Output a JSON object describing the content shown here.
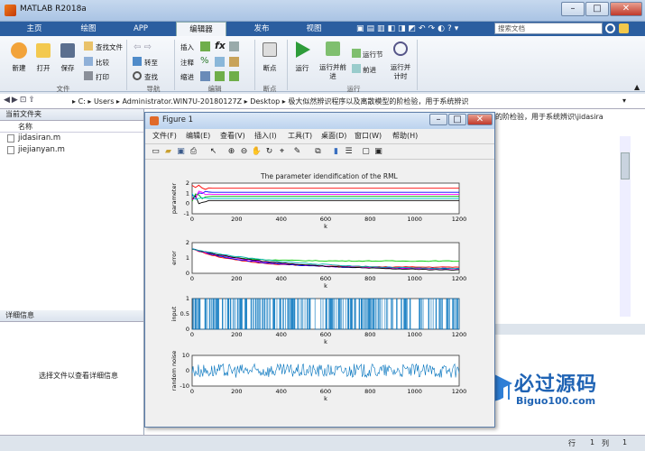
{
  "window": {
    "title": "MATLAB R2018a"
  },
  "tabs": [
    "主页",
    "绘图",
    "APP",
    "编辑器",
    "发布",
    "视图"
  ],
  "search": {
    "placeholder": "搜索文档"
  },
  "ribbon": {
    "file": [
      "新建",
      "打开",
      "保存"
    ],
    "file_small": [
      "查找文件",
      "比较",
      "打印"
    ],
    "nav": [
      "转至",
      "查找"
    ],
    "edit": [
      "插入",
      "注释",
      "缩进"
    ],
    "breakpoint": "断点",
    "run": [
      "运行",
      "运行并前进",
      "运行节",
      "前进",
      "运行并计时"
    ],
    "groups": [
      "文件",
      "导航",
      "编辑",
      "断点",
      "运行"
    ]
  },
  "address": {
    "path": [
      "C:",
      "Users",
      "Administrator.WIN7U-20180127Z",
      "Desktop",
      "极大似然辨识程序以及离散模型的阶检验，用于系统辨识"
    ]
  },
  "current_folder": {
    "title": "当前文件夹",
    "column": "名称",
    "files": [
      "jidasiran.m",
      "jiejianyan.m"
    ]
  },
  "details": {
    "title": "详细信息",
    "message": "选择文件以查看详细信息"
  },
  "right_path_text": "的阶检验，用于系统辨识\\jidasira",
  "figure": {
    "title": "Figure 1",
    "menu": [
      "文件(F)",
      "编辑(E)",
      "查看(V)",
      "插入(I)",
      "工具(T)",
      "桌面(D)",
      "窗口(W)",
      "帮助(H)"
    ],
    "plot_title": "The parameter idendification of the RML"
  },
  "chart_data": [
    {
      "type": "line",
      "ylabel": "parameter",
      "xlabel": "k",
      "xlim": [
        0,
        1200
      ],
      "ylim": [
        -1,
        2
      ],
      "yticks": [
        "2",
        "1",
        "0",
        "-1"
      ],
      "xticks": [
        "0",
        "200",
        "400",
        "600",
        "800",
        "1000",
        "1200"
      ],
      "series": [
        {
          "color": "#ff0000",
          "values": [
            1.5,
            1.5,
            1.5
          ]
        },
        {
          "color": "#0000ff",
          "values": [
            1.1,
            1.1,
            1.1
          ]
        },
        {
          "color": "#00aa00",
          "values": [
            0.7,
            0.7,
            0.7
          ]
        },
        {
          "color": "#000000",
          "values": [
            0.3,
            0.3,
            0.3
          ]
        },
        {
          "color": "#ff00ff",
          "values": [
            0.9,
            0.9,
            0.9
          ]
        },
        {
          "color": "#00cccc",
          "values": [
            0.5,
            0.5,
            0.5
          ]
        }
      ]
    },
    {
      "type": "line",
      "ylabel": "error",
      "xlabel": "k",
      "xlim": [
        0,
        1200
      ],
      "ylim": [
        0,
        2
      ],
      "yticks": [
        "2",
        "1",
        "0"
      ],
      "xticks": [
        "0",
        "200",
        "400",
        "600",
        "800",
        "1000",
        "1200"
      ]
    },
    {
      "type": "line",
      "ylabel": "input",
      "xlabel": "k",
      "xlim": [
        0,
        1200
      ],
      "ylim": [
        0,
        1
      ],
      "yticks": [
        "1",
        "0.5",
        "0"
      ],
      "xticks": [
        "0",
        "200",
        "400",
        "600",
        "800",
        "1000",
        "1200"
      ]
    },
    {
      "type": "line",
      "ylabel": "random noise",
      "xlabel": "k",
      "xlim": [
        0,
        1200
      ],
      "ylim": [
        -10,
        10
      ],
      "yticks": [
        "10",
        "0",
        "-10"
      ],
      "xticks": [
        "0",
        "200",
        "400",
        "600",
        "800",
        "1000",
        "1200"
      ]
    }
  ],
  "status": {
    "row_label": "行",
    "row": "1",
    "col_label": "列",
    "col": "1"
  },
  "watermark": {
    "text": "必过源码",
    "url": "Biguo100.com"
  }
}
